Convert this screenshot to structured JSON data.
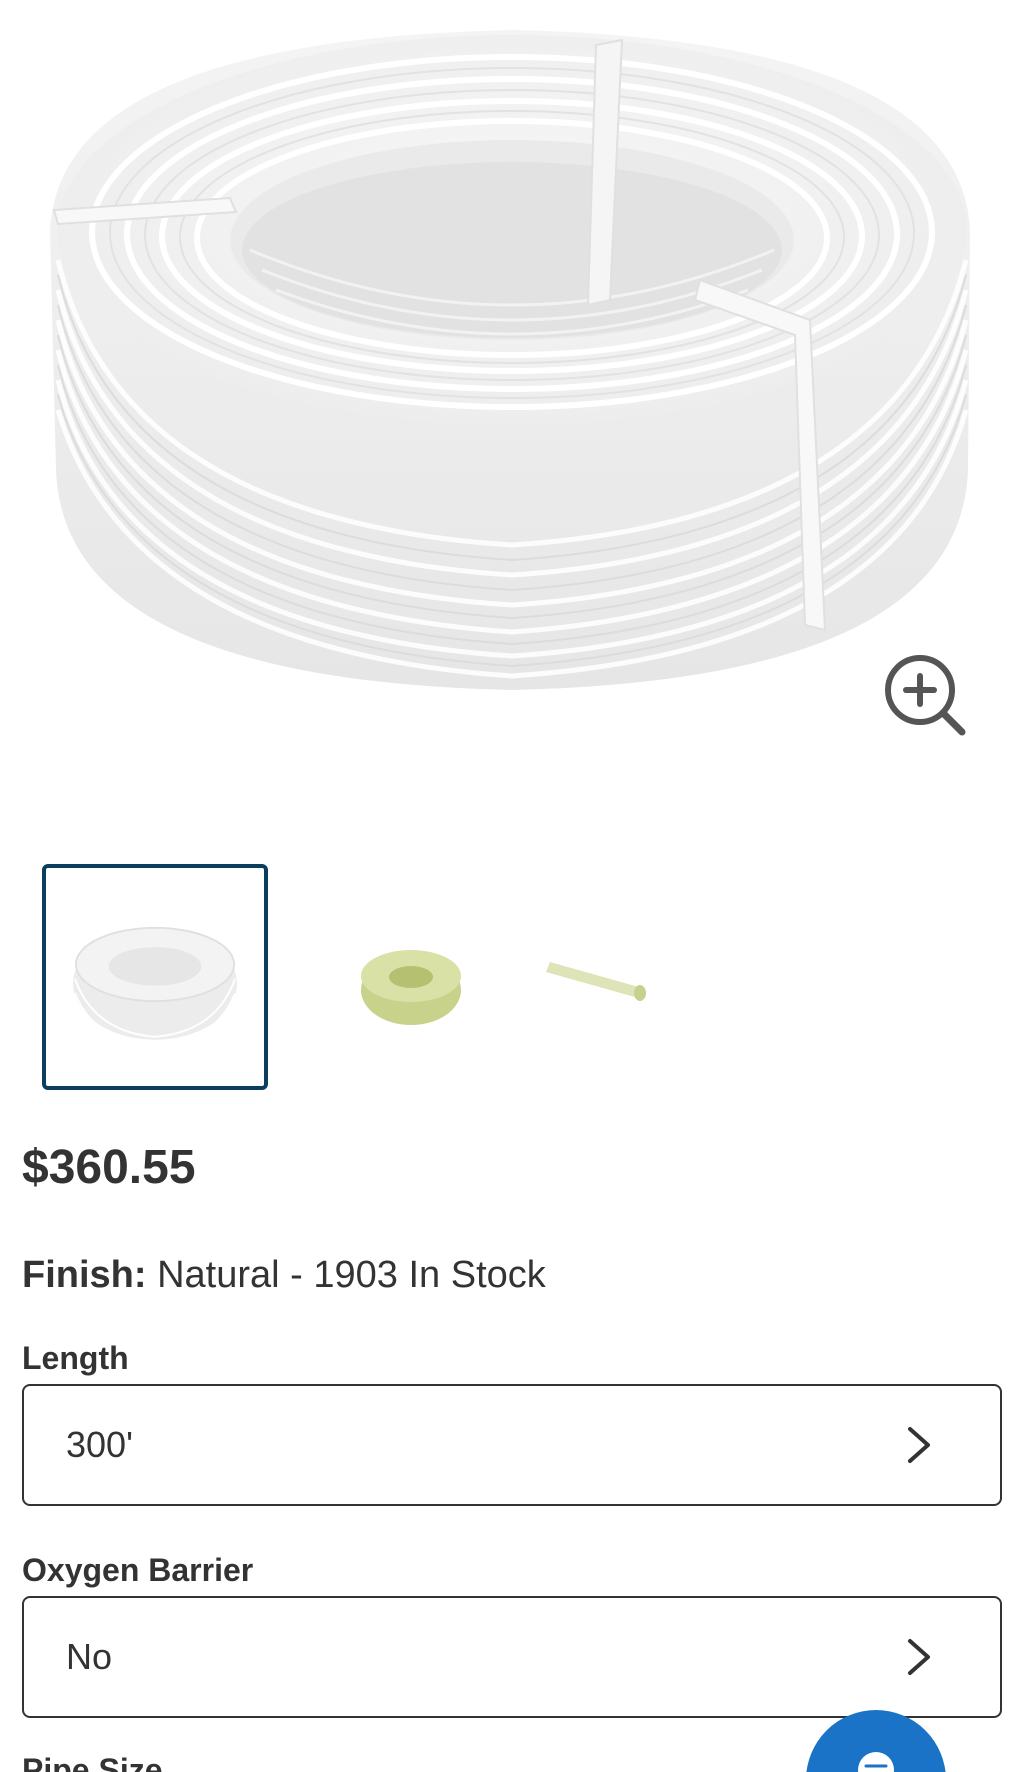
{
  "product": {
    "main_image_alt": "",
    "thumbnails": [
      {
        "name": "thumb-coil-white",
        "selected": true
      },
      {
        "name": "thumb-coil-green",
        "selected": false
      },
      {
        "name": "thumb-pipe-segment",
        "selected": false
      }
    ],
    "price": "$360.55",
    "finish": {
      "label": "Finish:",
      "value": "Natural - 1903 In Stock"
    },
    "options": [
      {
        "label": "Length",
        "value": "300'"
      },
      {
        "label": "Oxygen Barrier",
        "value": "No"
      }
    ],
    "partial_next_label": "Pipe Size"
  },
  "icons": {
    "zoom": "zoom-in-icon",
    "chevron": "chevron-right-icon",
    "chat": "chat-icon"
  },
  "colors": {
    "selected_border": "#0b3d5c",
    "fab": "#1a73c7",
    "text": "#333333"
  }
}
